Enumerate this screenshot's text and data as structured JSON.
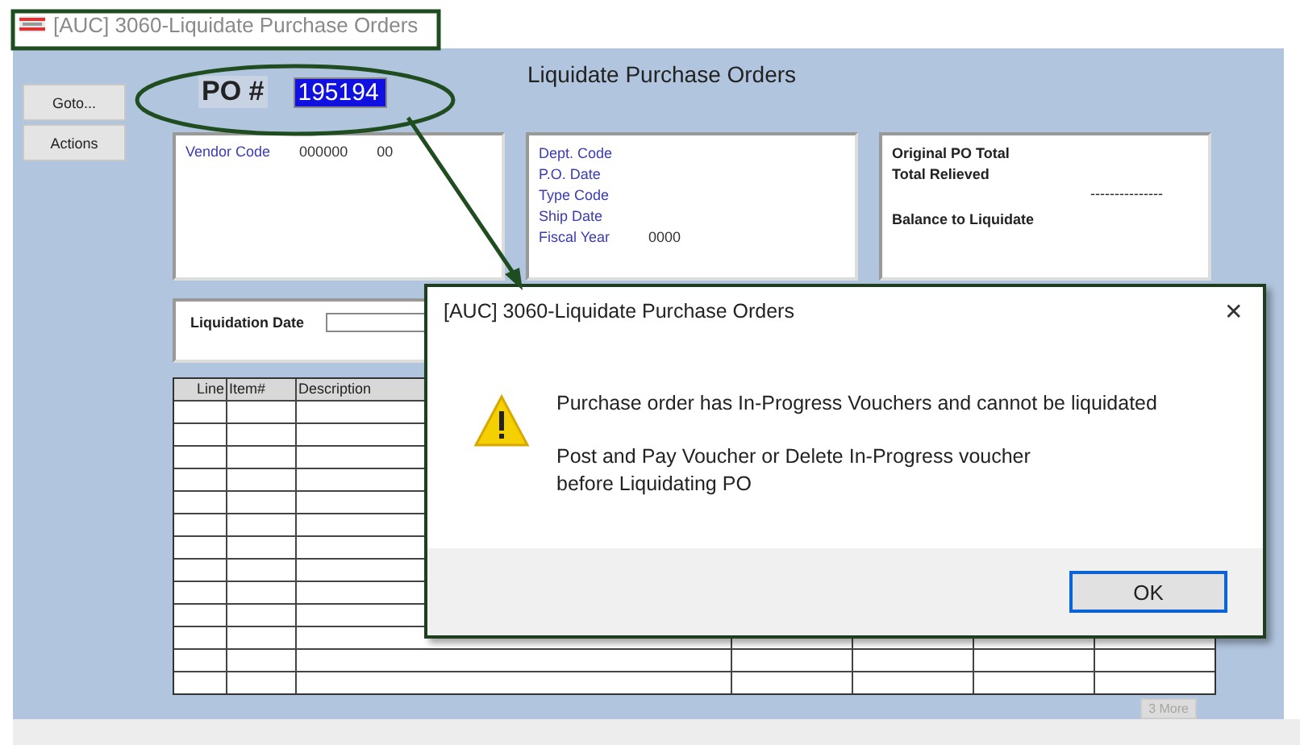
{
  "window": {
    "title": "[AUC] 3060-Liquidate Purchase Orders"
  },
  "sidebar_buttons": [
    "Goto...",
    "Actions"
  ],
  "heading": "Liquidate Purchase Orders",
  "po": {
    "label": "PO #",
    "value": "195194",
    "selected": true
  },
  "vendor_panel": {
    "label": "Vendor Code",
    "values": [
      "000000",
      "00"
    ]
  },
  "info_panel": {
    "fields": [
      {
        "label": "Dept. Code"
      },
      {
        "label": "P.O. Date"
      },
      {
        "label": "Type Code"
      },
      {
        "label": "Ship Date"
      },
      {
        "label": "Fiscal Year",
        "value": "0000"
      }
    ]
  },
  "totals_panel": {
    "lines": [
      {
        "kind": "label",
        "text": "Original PO Total"
      },
      {
        "kind": "label",
        "text": "Total Relieved"
      },
      {
        "kind": "rule",
        "text": "---------------"
      },
      {
        "kind": "label",
        "text": "Balance to Liquidate"
      }
    ]
  },
  "liquidation_date": {
    "label": "Liquidation Date"
  },
  "table": {
    "columns": [
      "Line",
      "Item#",
      "Description"
    ]
  },
  "more_button": {
    "label": "3 More",
    "disabled": true
  },
  "dialog": {
    "title": "[AUC] 3060-Liquidate Purchase Orders",
    "close": "✕",
    "messages": [
      "Purchase order has In-Progress Vouchers and cannot be liquidated",
      "Post and Pay Voucher or Delete In-Progress voucher\nbefore Liquidating PO"
    ],
    "buttons": [
      {
        "label": "OK",
        "selected": true
      }
    ]
  }
}
